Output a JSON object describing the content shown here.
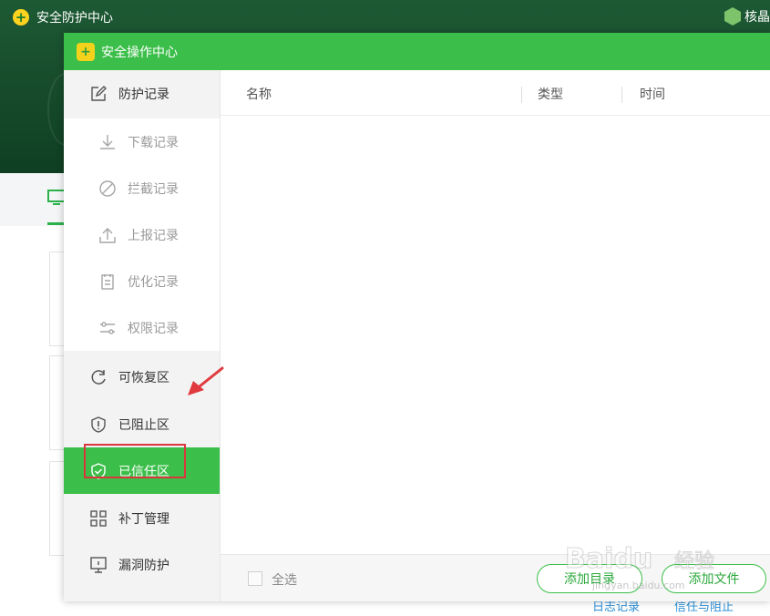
{
  "background_window": {
    "title": "安全防护中心",
    "user_label": "核晶",
    "bottom_links": [
      "日志记录",
      "信任与阻止"
    ]
  },
  "dialog": {
    "title": "安全操作中心",
    "sidebar": {
      "protection_records": "防护记录",
      "download_records": "下载记录",
      "block_records": "拦截记录",
      "report_records": "上报记录",
      "optimize_records": "优化记录",
      "permission_records": "权限记录",
      "recoverable_zone": "可恢复区",
      "blocked_zone": "已阻止区",
      "trusted_zone": "已信任区",
      "patch_management": "补丁管理",
      "vulnerability_protection": "漏洞防护",
      "active_item": "已信任区"
    },
    "table": {
      "columns": [
        "名称",
        "类型",
        "时间"
      ],
      "rows": []
    },
    "footer": {
      "select_all": "全选",
      "add_directory": "添加目录",
      "add_file": "添加文件"
    }
  },
  "watermark": {
    "brand": "Baidu",
    "brand_cn": "经验",
    "url": "jingyan.baidu.com"
  },
  "colors": {
    "accent_green": "#3cbf4a",
    "dark_header": "#174b2b",
    "highlight_red": "#d9363e",
    "sidebar_bg": "#f3f3f3"
  },
  "icons": {
    "protection_records": "edit-icon",
    "download_records": "download-icon",
    "block_records": "block-icon",
    "report_records": "upload-icon",
    "optimize_records": "clipboard-icon",
    "permission_records": "sliders-icon",
    "recoverable_zone": "refresh-icon",
    "blocked_zone": "shield-alert-icon",
    "trusted_zone": "shield-check-icon",
    "patch_management": "grid-icon",
    "vulnerability_protection": "monitor-pin-icon"
  }
}
